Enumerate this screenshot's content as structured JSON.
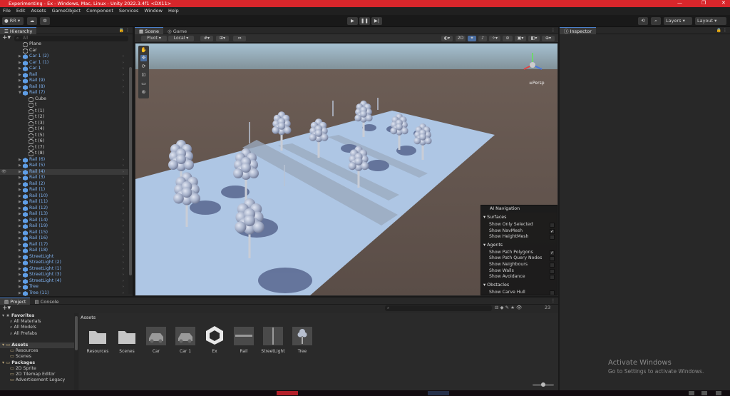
{
  "window": {
    "title": "Experimenting - Ex - Windows, Mac, Linux - Unity 2022.3.4f1 <DX11>",
    "min": "—",
    "max": "❐",
    "close": "✕"
  },
  "menu": [
    "File",
    "Edit",
    "Assets",
    "GameObject",
    "Component",
    "Services",
    "Window",
    "Help"
  ],
  "toolbar": {
    "account": "RR",
    "layers": "Layers",
    "layout": "Layout"
  },
  "hierarchy": {
    "title": "Hierarchy",
    "search_placeholder": "All",
    "items": [
      {
        "label": "Plane",
        "depth": 1,
        "expand": false,
        "prefab": false,
        "arrow": false
      },
      {
        "label": "Car",
        "depth": 1,
        "expand": false,
        "prefab": false,
        "arrow": false
      },
      {
        "label": "Car 1 (2)",
        "depth": 1,
        "expand": true,
        "prefab": true,
        "arrow": true
      },
      {
        "label": "Car 1 (1)",
        "depth": 1,
        "expand": true,
        "prefab": true,
        "arrow": true
      },
      {
        "label": "Car 1",
        "depth": 1,
        "expand": true,
        "prefab": true,
        "arrow": true
      },
      {
        "label": "Rail",
        "depth": 1,
        "expand": true,
        "prefab": true,
        "arrow": true
      },
      {
        "label": "Rail (9)",
        "depth": 1,
        "expand": true,
        "prefab": true,
        "arrow": true
      },
      {
        "label": "Rail (8)",
        "depth": 1,
        "expand": true,
        "prefab": true,
        "arrow": true
      },
      {
        "label": "Rail (7)",
        "depth": 1,
        "expand": true,
        "prefab": true,
        "arrow": true,
        "open": true
      },
      {
        "label": "Cube",
        "depth": 2,
        "expand": false,
        "prefab": false,
        "arrow": false
      },
      {
        "label": "t",
        "depth": 2,
        "expand": false,
        "prefab": false,
        "arrow": false
      },
      {
        "label": "t (1)",
        "depth": 2,
        "expand": false,
        "prefab": false,
        "arrow": false
      },
      {
        "label": "t (2)",
        "depth": 2,
        "expand": false,
        "prefab": false,
        "arrow": false
      },
      {
        "label": "t (3)",
        "depth": 2,
        "expand": false,
        "prefab": false,
        "arrow": false
      },
      {
        "label": "t (4)",
        "depth": 2,
        "expand": false,
        "prefab": false,
        "arrow": false
      },
      {
        "label": "t (5)",
        "depth": 2,
        "expand": false,
        "prefab": false,
        "arrow": false
      },
      {
        "label": "t (6)",
        "depth": 2,
        "expand": false,
        "prefab": false,
        "arrow": false
      },
      {
        "label": "t (7)",
        "depth": 2,
        "expand": false,
        "prefab": false,
        "arrow": false
      },
      {
        "label": "t (8)",
        "depth": 2,
        "expand": false,
        "prefab": false,
        "arrow": false
      },
      {
        "label": "Rail (6)",
        "depth": 1,
        "expand": true,
        "prefab": true,
        "arrow": true
      },
      {
        "label": "Rail (5)",
        "depth": 1,
        "expand": true,
        "prefab": true,
        "arrow": true
      },
      {
        "label": "Rail (4)",
        "depth": 1,
        "expand": true,
        "prefab": true,
        "arrow": true,
        "selected": true
      },
      {
        "label": "Rail (3)",
        "depth": 1,
        "expand": true,
        "prefab": true,
        "arrow": true
      },
      {
        "label": "Rail (2)",
        "depth": 1,
        "expand": true,
        "prefab": true,
        "arrow": true
      },
      {
        "label": "Rail (1)",
        "depth": 1,
        "expand": true,
        "prefab": true,
        "arrow": true
      },
      {
        "label": "Rail (10)",
        "depth": 1,
        "expand": true,
        "prefab": true,
        "arrow": true
      },
      {
        "label": "Rail (11)",
        "depth": 1,
        "expand": true,
        "prefab": true,
        "arrow": true
      },
      {
        "label": "Rail (12)",
        "depth": 1,
        "expand": true,
        "prefab": true,
        "arrow": true
      },
      {
        "label": "Rail (13)",
        "depth": 1,
        "expand": true,
        "prefab": true,
        "arrow": true
      },
      {
        "label": "Rail (14)",
        "depth": 1,
        "expand": true,
        "prefab": true,
        "arrow": true
      },
      {
        "label": "Rail (19)",
        "depth": 1,
        "expand": true,
        "prefab": true,
        "arrow": true
      },
      {
        "label": "Rail (15)",
        "depth": 1,
        "expand": true,
        "prefab": true,
        "arrow": true
      },
      {
        "label": "Rail (16)",
        "depth": 1,
        "expand": true,
        "prefab": true,
        "arrow": true
      },
      {
        "label": "Rail (17)",
        "depth": 1,
        "expand": true,
        "prefab": true,
        "arrow": true
      },
      {
        "label": "Rail (18)",
        "depth": 1,
        "expand": true,
        "prefab": true,
        "arrow": true
      },
      {
        "label": "StreetLight",
        "depth": 1,
        "expand": true,
        "prefab": true,
        "arrow": true
      },
      {
        "label": "StreetLight (2)",
        "depth": 1,
        "expand": true,
        "prefab": true,
        "arrow": true
      },
      {
        "label": "StreetLight (1)",
        "depth": 1,
        "expand": true,
        "prefab": true,
        "arrow": true
      },
      {
        "label": "StreetLight (3)",
        "depth": 1,
        "expand": true,
        "prefab": true,
        "arrow": true
      },
      {
        "label": "StreetLight (4)",
        "depth": 1,
        "expand": true,
        "prefab": true,
        "arrow": true
      },
      {
        "label": "Tree",
        "depth": 1,
        "expand": true,
        "prefab": true,
        "arrow": true
      },
      {
        "label": "Tree (11)",
        "depth": 1,
        "expand": true,
        "prefab": true,
        "arrow": true
      }
    ]
  },
  "scene": {
    "tabs": [
      "Scene",
      "Game"
    ],
    "pivot": "Pivot",
    "space": "Local",
    "mode2d": "2D",
    "persp": "≡Persp",
    "ai_nav": {
      "title": "AI Navigation",
      "sections": [
        {
          "name": "Surfaces",
          "rows": [
            {
              "label": "Show Only Selected",
              "checked": false
            },
            {
              "label": "Show NavMesh",
              "checked": true
            },
            {
              "label": "Show HeightMesh",
              "checked": false
            }
          ]
        },
        {
          "name": "Agents",
          "rows": [
            {
              "label": "Show Path Polygons",
              "checked": true
            },
            {
              "label": "Show Path Query Nodes",
              "checked": false
            },
            {
              "label": "Show Neighbours",
              "checked": false
            },
            {
              "label": "Show Walls",
              "checked": false
            },
            {
              "label": "Show Avoidance",
              "checked": false
            }
          ]
        },
        {
          "name": "Obstacles",
          "rows": [
            {
              "label": "Show Carve Hull",
              "checked": false
            }
          ]
        }
      ]
    }
  },
  "inspector": {
    "title": "Inspector"
  },
  "project": {
    "tabs": [
      "Project",
      "Console"
    ],
    "breadcrumb": "Assets",
    "count": "23",
    "tree": [
      {
        "label": "Favorites",
        "bold": true,
        "indent": 0,
        "icon": "star"
      },
      {
        "label": "All Materials",
        "bold": false,
        "indent": 1,
        "icon": "search"
      },
      {
        "label": "All Models",
        "bold": false,
        "indent": 1,
        "icon": "search"
      },
      {
        "label": "All Prefabs",
        "bold": false,
        "indent": 1,
        "icon": "search"
      },
      {
        "label": "",
        "bold": false,
        "indent": 0,
        "icon": "none"
      },
      {
        "label": "Assets",
        "bold": true,
        "indent": 0,
        "icon": "folder",
        "selected": true
      },
      {
        "label": "Resources",
        "bold": false,
        "indent": 1,
        "icon": "folder"
      },
      {
        "label": "Scenes",
        "bold": false,
        "indent": 1,
        "icon": "folder"
      },
      {
        "label": "Packages",
        "bold": true,
        "indent": 0,
        "icon": "folder"
      },
      {
        "label": "2D Sprite",
        "bold": false,
        "indent": 1,
        "icon": "folder"
      },
      {
        "label": "2D Tilemap Editor",
        "bold": false,
        "indent": 1,
        "icon": "folder"
      },
      {
        "label": "Advertisement Legacy",
        "bold": false,
        "indent": 1,
        "icon": "folder"
      }
    ],
    "assets": [
      {
        "name": "Resources",
        "kind": "folder"
      },
      {
        "name": "Scenes",
        "kind": "folder"
      },
      {
        "name": "Car",
        "kind": "car"
      },
      {
        "name": "Car 1",
        "kind": "car"
      },
      {
        "name": "Ex",
        "kind": "unity"
      },
      {
        "name": "Rail",
        "kind": "rail"
      },
      {
        "name": "StreetLight",
        "kind": "light"
      },
      {
        "name": "Tree",
        "kind": "tree"
      }
    ]
  },
  "watermark": {
    "line1": "Activate Windows",
    "line2": "Go to Settings to activate Windows."
  },
  "colors": {
    "title_bar": "#d8262b",
    "prefab_text": "#7fb2f0",
    "sky": "#8faab9",
    "ground": "#5b4e48",
    "navmesh": "#a9c4e6"
  }
}
